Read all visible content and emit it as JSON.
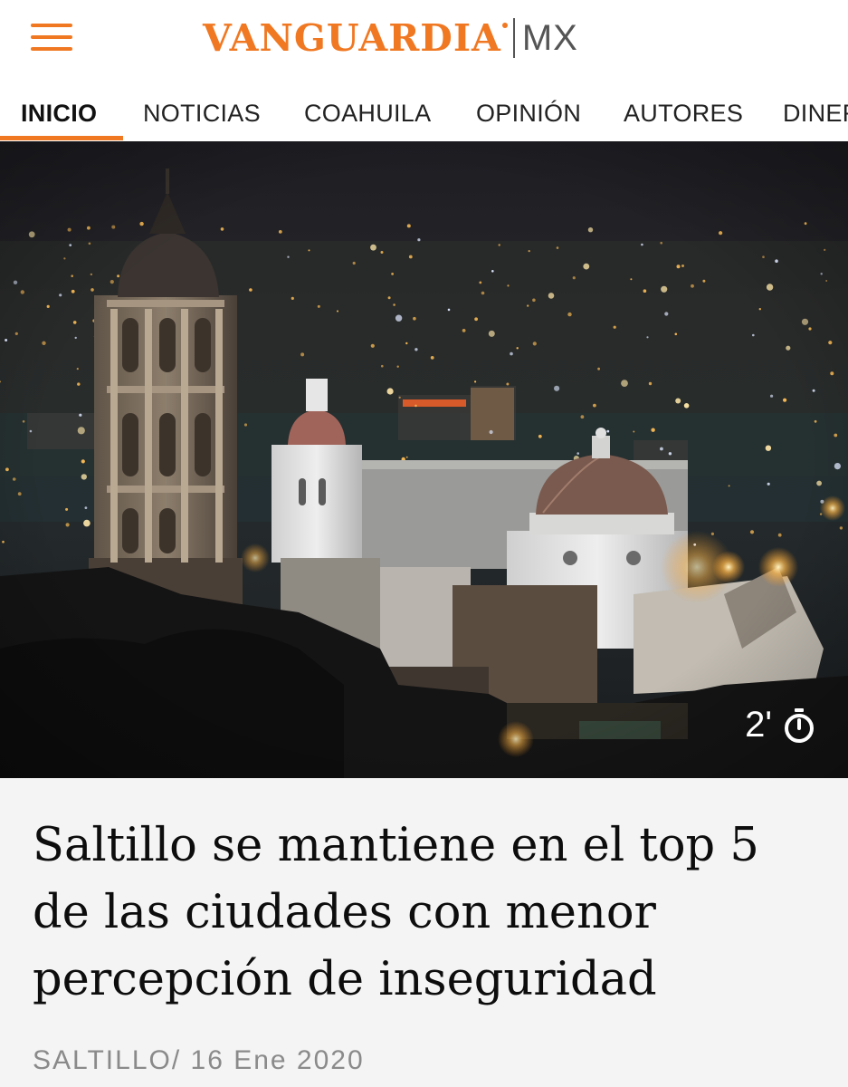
{
  "header": {
    "logo_text": "VANGUARDIA",
    "logo_suffix": "MX",
    "brand_color": "#f07822"
  },
  "nav": {
    "tabs": [
      {
        "label": "INICIO",
        "active": true
      },
      {
        "label": "NOTICIAS",
        "active": false
      },
      {
        "label": "COAHUILA",
        "active": false
      },
      {
        "label": "OPINIÓN",
        "active": false
      },
      {
        "label": "AUTORES",
        "active": false
      },
      {
        "label": "DINERO",
        "active": false
      }
    ]
  },
  "hero": {
    "read_time": "2'",
    "read_time_icon": "stopwatch-icon"
  },
  "article": {
    "headline": "Saltillo se mantiene en el top 5 de las ciudades con menor percepción de inseguridad",
    "section": "SALTILLO",
    "date": "16 Ene 2020"
  }
}
